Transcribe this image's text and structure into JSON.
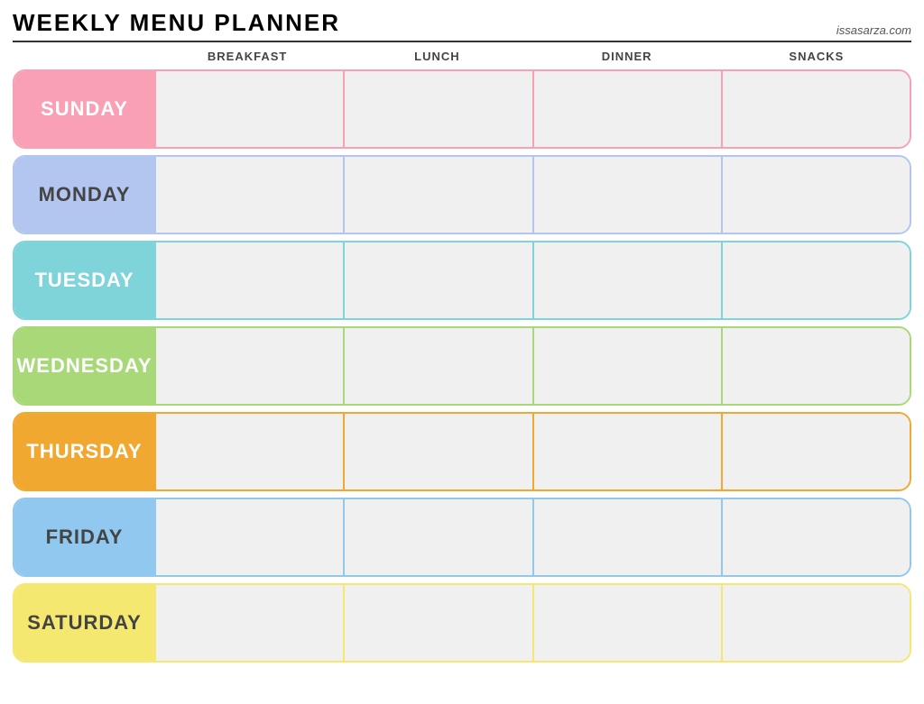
{
  "header": {
    "title": "Weekly Menu Planner",
    "site": "issasarza.com"
  },
  "columns": {
    "empty": "",
    "breakfast": "Breakfast",
    "lunch": "Lunch",
    "dinner": "Dinner",
    "snacks": "Snacks"
  },
  "days": [
    {
      "id": "sunday",
      "label": "Sunday",
      "class": "day-sunday"
    },
    {
      "id": "monday",
      "label": "Monday",
      "class": "day-monday"
    },
    {
      "id": "tuesday",
      "label": "Tuesday",
      "class": "day-tuesday"
    },
    {
      "id": "wednesday",
      "label": "Wednesday",
      "class": "day-wednesday"
    },
    {
      "id": "thursday",
      "label": "Thursday",
      "class": "day-thursday"
    },
    {
      "id": "friday",
      "label": "Friday",
      "class": "day-friday"
    },
    {
      "id": "saturday",
      "label": "Saturday",
      "class": "day-saturday"
    }
  ]
}
